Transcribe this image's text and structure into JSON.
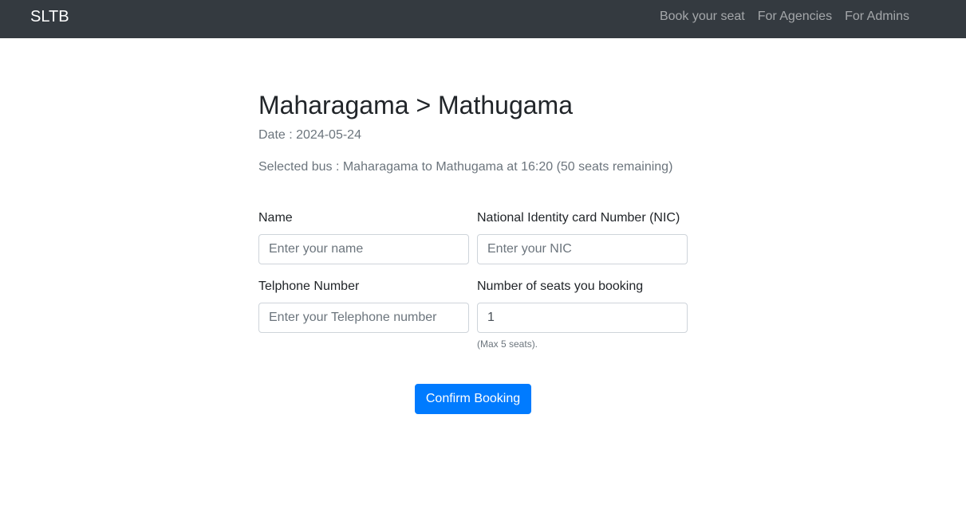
{
  "navbar": {
    "brand": "SLTB",
    "links": [
      "Book your seat",
      "For Agencies",
      "For Admins"
    ]
  },
  "page": {
    "title": "Maharagama > Mathugama",
    "date": "Date : 2024-05-24",
    "selected_bus": "Selected bus : Maharagama to Mathugama at 16:20 (50 seats remaining)"
  },
  "form": {
    "name": {
      "label": "Name",
      "placeholder": "Enter your name",
      "value": ""
    },
    "nic": {
      "label": "National Identity card Number (NIC)",
      "placeholder": "Enter your NIC",
      "value": ""
    },
    "telephone": {
      "label": "Telphone Number",
      "placeholder": "Enter your Telephone number",
      "value": ""
    },
    "seats": {
      "label": "Number of seats you booking",
      "value": "1",
      "help": "(Max 5 seats)."
    },
    "submit_label": "Confirm Booking"
  },
  "colors": {
    "navbar_bg": "#343a40",
    "primary": "#007bff",
    "muted": "#6c757d"
  }
}
